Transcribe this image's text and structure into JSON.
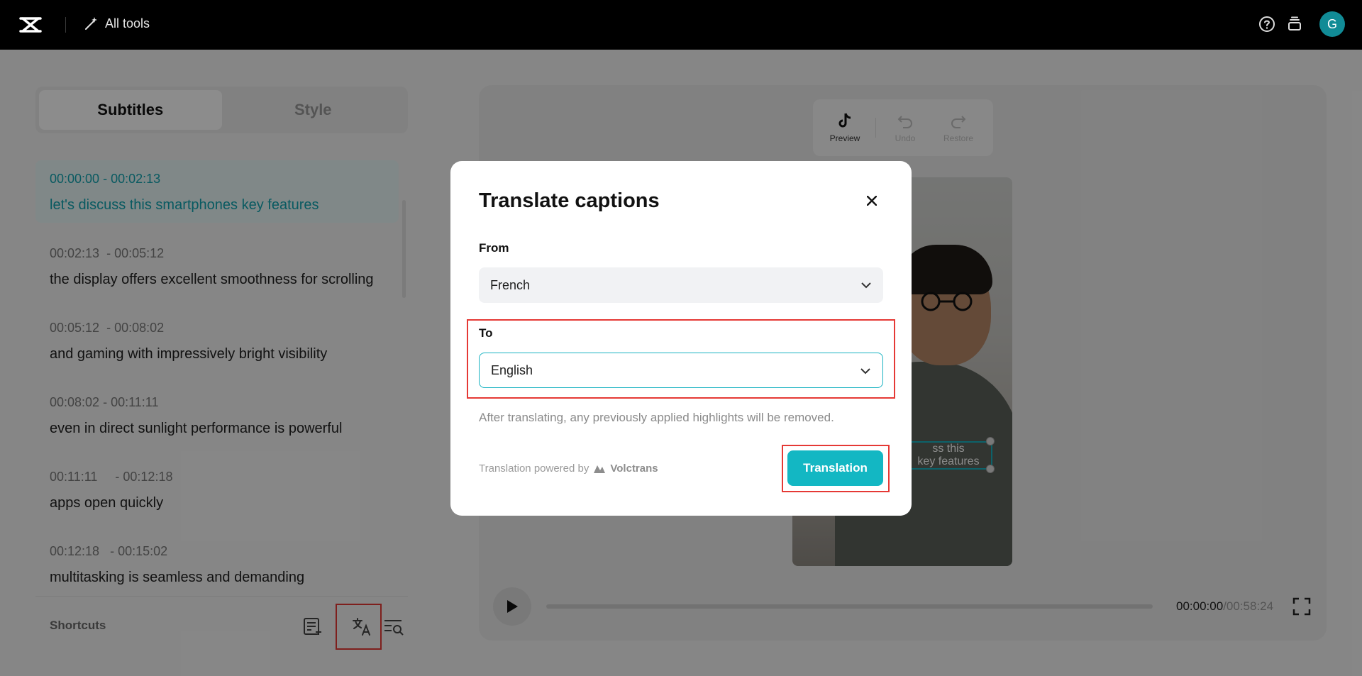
{
  "header": {
    "all_tools_label": "All tools",
    "avatar_initial": "G"
  },
  "tabs": [
    {
      "label": "Subtitles",
      "active": true
    },
    {
      "label": "Style",
      "active": false
    }
  ],
  "captions": [
    {
      "time": "00:00:00 - 00:02:13",
      "text": "let's discuss this smartphones key features",
      "active": true
    },
    {
      "time": "00:02:13  - 00:05:12",
      "text": "the display offers excellent smoothness for scrolling",
      "active": false
    },
    {
      "time": "00:05:12  - 00:08:02",
      "text": "and gaming with impressively bright visibility",
      "active": false
    },
    {
      "time": "00:08:02 - 00:11:11",
      "text": "even in direct sunlight performance is powerful",
      "active": false
    },
    {
      "time": "00:11:11     - 00:12:18",
      "text": "apps open quickly",
      "active": false
    },
    {
      "time": "00:12:18   - 00:15:02",
      "text": "multitasking is seamless and demanding",
      "active": false
    }
  ],
  "shortcuts": {
    "label": "Shortcuts"
  },
  "toolbar": {
    "preview_label": "Preview",
    "undo_label": "Undo",
    "restore_label": "Restore"
  },
  "video": {
    "caption_overlay": "ss this\nkey features"
  },
  "player": {
    "current_time": "00:00:00",
    "total_time": "/00:58:24"
  },
  "modal": {
    "title": "Translate captions",
    "from_label": "From",
    "from_value": "French",
    "to_label": "To",
    "to_value": "English",
    "note": "After translating, any previously applied highlights will be removed.",
    "powered_by": "Translation powered by",
    "powered_brand": "Volctrans",
    "translate_button": "Translation"
  },
  "colors": {
    "accent": "#13b7c3",
    "highlight_box": "#e53935"
  }
}
